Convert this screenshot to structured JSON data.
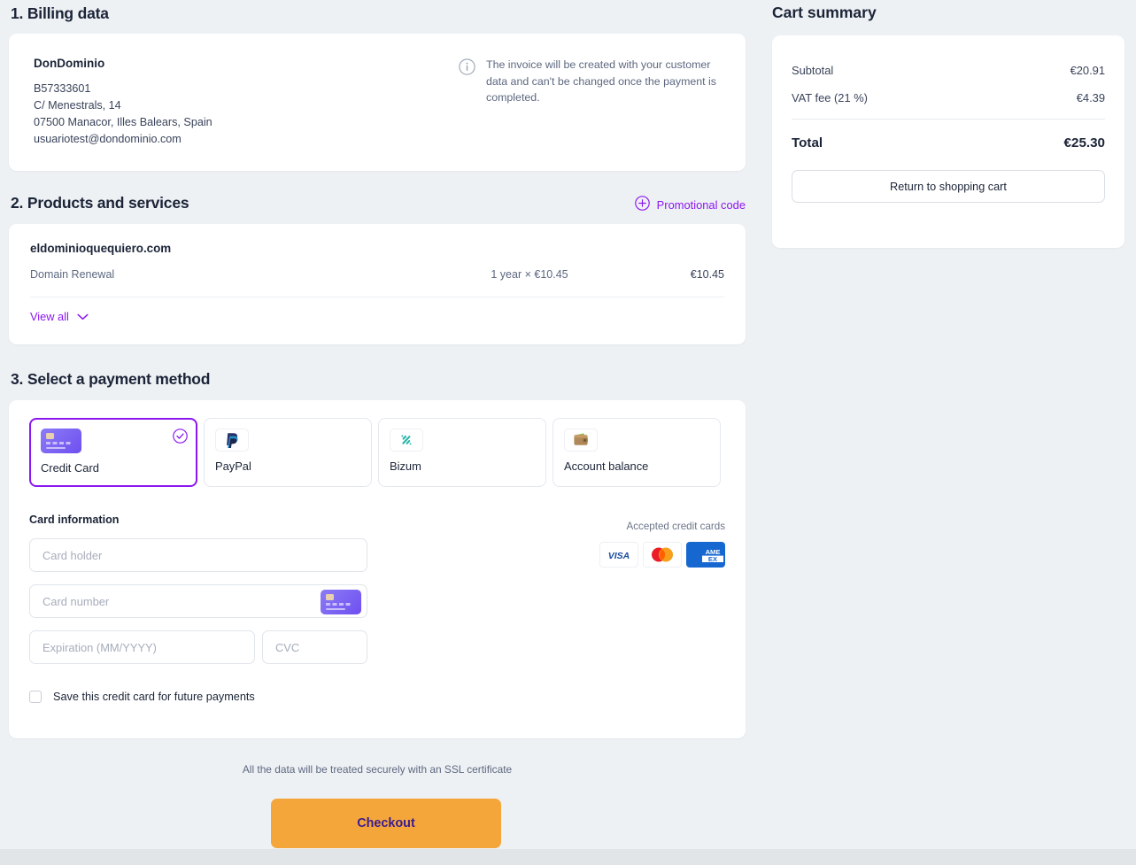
{
  "sections": {
    "billing": {
      "title": "1. Billing data",
      "company": "DonDominio",
      "tax_id": "B57333601",
      "address_line": "C/ Menestrals, 14",
      "city_line": "07500 Manacor, Illes Balears, Spain",
      "email": "usuariotest@dondominio.com",
      "notice": "The invoice will be created with your customer data and can't be changed once the payment is completed."
    },
    "products": {
      "title": "2. Products and services",
      "promo_label": "Promotional code",
      "items": [
        {
          "domain": "eldominioquequiero.com",
          "name": "Domain Renewal",
          "quantity": "1 year × €10.45",
          "price": "€10.45"
        }
      ],
      "view_all_label": "View all"
    },
    "payment": {
      "title": "3. Select a payment method",
      "methods": [
        {
          "label": "Credit Card",
          "icon": "credit-card-icon",
          "selected": true
        },
        {
          "label": "PayPal",
          "icon": "paypal-icon",
          "selected": false
        },
        {
          "label": "Bizum",
          "icon": "bizum-icon",
          "selected": false
        },
        {
          "label": "Account balance",
          "icon": "wallet-icon",
          "selected": false
        }
      ],
      "card_info_label": "Card information",
      "fields": {
        "card_holder_placeholder": "Card holder",
        "card_number_placeholder": "Card number",
        "expiration_placeholder": "Expiration (MM/YYYY)",
        "cvc_placeholder": "CVC"
      },
      "save_card_label": "Save this credit card for future payments",
      "save_card_checked": false,
      "accepted_label": "Accepted credit cards",
      "accepted_cards": [
        "VISA",
        "Mastercard",
        "AMERICAN EXPRESS"
      ]
    }
  },
  "footer": {
    "ssl_note": "All the data will be treated securely with an SSL certificate",
    "checkout_label": "Checkout"
  },
  "cart": {
    "title": "Cart summary",
    "rows": [
      {
        "label": "Subtotal",
        "value": "€20.91"
      },
      {
        "label": "VAT fee (21 %)",
        "value": "€4.39"
      }
    ],
    "total_label": "Total",
    "total_value": "€25.30",
    "return_label": "Return to shopping cart"
  },
  "colors": {
    "accent_purple": "#8b17f0",
    "checkout_orange": "#f5a63a",
    "checkout_text": "#3b1d8f",
    "page_bg": "#eef1f4"
  }
}
